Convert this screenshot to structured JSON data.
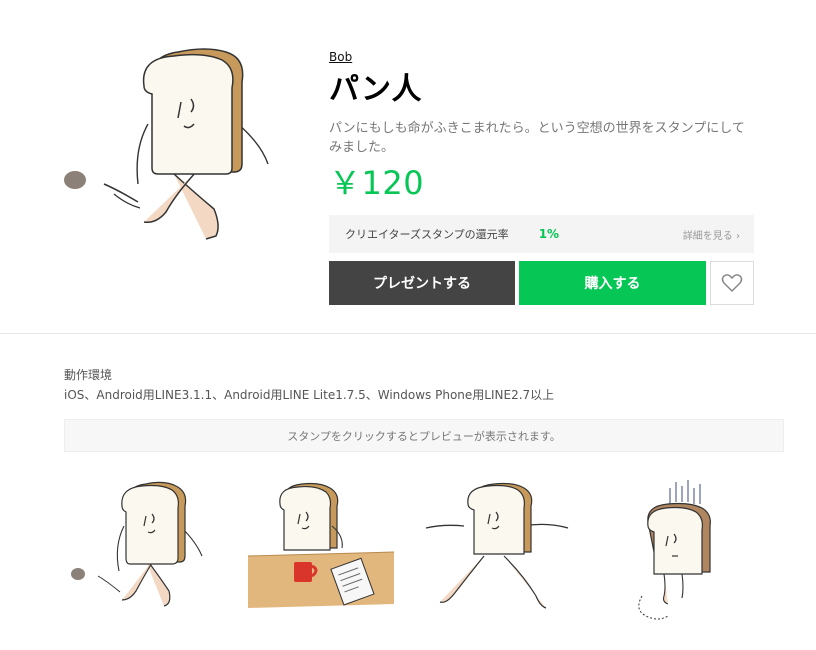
{
  "product": {
    "author": "Bob",
    "title": "パン人",
    "description": "パンにもしも命がふきこまれたら。という空想の世界をスタンプにしてみました。",
    "price": "￥120"
  },
  "rebate": {
    "label": "クリエイターズスタンプの還元率",
    "percent": "1%",
    "link": "詳細を見る ›"
  },
  "actions": {
    "gift_label": "プレゼントする",
    "buy_label": "購入する",
    "favorite_icon": "heart-icon"
  },
  "environment": {
    "label": "動作環境",
    "value": "iOS、Android用LINE3.1.1、Android用LINE Lite1.7.5、Windows Phone用LINE2.7以上"
  },
  "preview_hint": "スタンプをクリックするとプレビューが表示されます。",
  "colors": {
    "accent": "#06c755",
    "gift_button": "#444444",
    "bread_crust": "#c79a5b"
  }
}
